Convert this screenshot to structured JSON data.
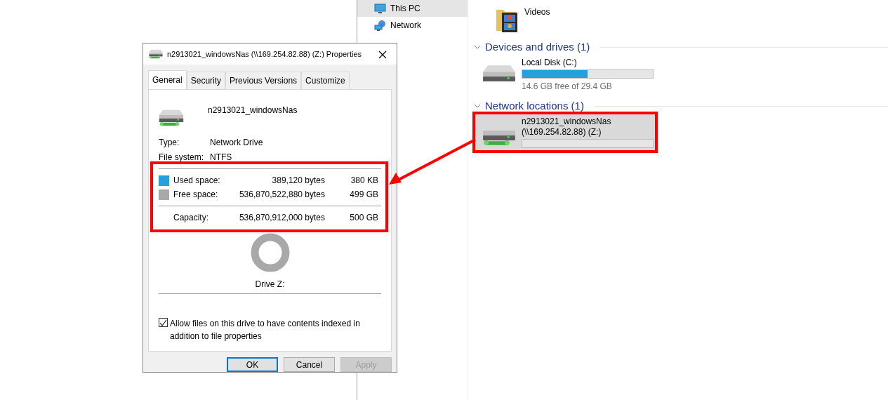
{
  "explorer": {
    "nav_items": [
      {
        "label": "This PC",
        "selected": true
      },
      {
        "label": "Network",
        "selected": false
      }
    ],
    "folders": [
      {
        "label": "Videos"
      }
    ],
    "groups": [
      {
        "title": "Devices and drives (1)",
        "expanded": true,
        "drives": [
          {
            "kind": "local",
            "name": "Local Disk (C:)",
            "level": 0.5,
            "free_text": "14.6 GB free of 29.4 GB",
            "selected": false,
            "highlighted": false
          }
        ]
      },
      {
        "title": "Network locations (1)",
        "expanded": true,
        "drives": [
          {
            "kind": "network",
            "name": "n2913021_windowsNas (\\\\169.254.82.88) (Z:)",
            "selected": true,
            "highlighted": true
          }
        ]
      }
    ]
  },
  "dialog": {
    "title": "n2913021_windowsNas (\\\\169.254.82.88) (Z:) Properties",
    "tabs": [
      {
        "label": "General",
        "selected": true
      },
      {
        "label": "Security",
        "selected": false
      },
      {
        "label": "Previous Versions",
        "selected": false
      },
      {
        "label": "Customize",
        "selected": false
      }
    ],
    "drive_name": "n2913021_windowsNas",
    "properties": [
      {
        "label": "Type:",
        "value": "Network Drive"
      },
      {
        "label": "File system:",
        "value": "NTFS"
      }
    ],
    "usage": [
      {
        "label": "Used space:",
        "color": "#26a0da",
        "bytes": "389,120 bytes",
        "size": "380 KB"
      },
      {
        "label": "Free space:",
        "color": "#a8a8a8",
        "bytes": "536,870,522,880 bytes",
        "size": "499 GB"
      }
    ],
    "capacity": {
      "label": "Capacity:",
      "bytes": "536,870,912,000 bytes",
      "size": "500 GB"
    },
    "usage_highlighted": true,
    "drive_label": "Drive Z:",
    "index_checkbox": {
      "label": "Allow files on this drive to have contents indexed in addition to file properties",
      "checked": true
    },
    "buttons": [
      {
        "label": "OK",
        "default": true,
        "disabled": false
      },
      {
        "label": "Cancel",
        "default": false,
        "disabled": false
      },
      {
        "label": "Apply",
        "default": false,
        "disabled": true
      }
    ]
  }
}
